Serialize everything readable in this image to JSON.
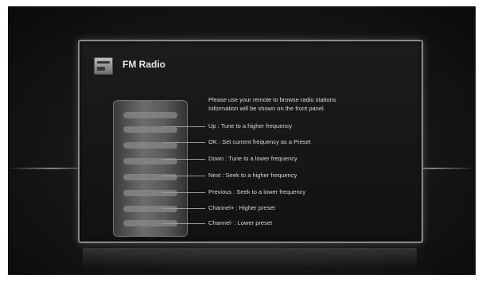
{
  "app": {
    "title": "FM Radio",
    "icon": "radio-icon"
  },
  "intro": {
    "line1": "Please use your remote to browse radio stations",
    "line2": "Information will be shown on the front panel."
  },
  "instructions": [
    "Up : Tune to a higher frequency",
    "OK : Set current frequency as a Preset",
    "Down : Tune to a lower frequency",
    "Next : Seek to a higher frequency",
    "Previous : Seek to a lower frequency",
    "Channel+ : Higher preset",
    "Channel- : Lower preset"
  ],
  "colors": {
    "panel_border": "#8a8a8a",
    "text": "#d8d8d8",
    "background": "#161616"
  }
}
